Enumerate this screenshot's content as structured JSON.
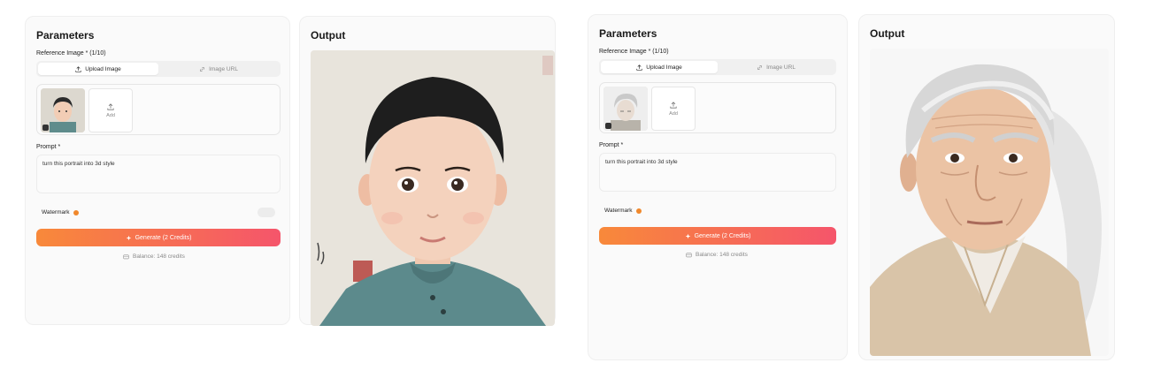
{
  "panels": [
    {
      "parameters_title": "Parameters",
      "reference_label": "Reference Image * (1/10)",
      "tabs": [
        {
          "label": "Upload Image",
          "icon": "upload-icon",
          "active": true
        },
        {
          "label": "Image URL",
          "icon": "link-icon",
          "active": false
        }
      ],
      "thumbnail": "boy-portrait-thumbnail",
      "add_label": "Add",
      "prompt_label": "Prompt *",
      "prompt_value": "turn this portrait into 3d style",
      "watermark_label": "Watermark",
      "generate_label": "Generate (2 Credits)",
      "balance_text": "Balance: 148 credits",
      "output_title": "Output",
      "output_image": "3d-boy-portrait"
    },
    {
      "parameters_title": "Parameters",
      "reference_label": "Reference Image * (1/10)",
      "tabs": [
        {
          "label": "Upload Image",
          "icon": "upload-icon",
          "active": true
        },
        {
          "label": "Image URL",
          "icon": "link-icon",
          "active": false
        }
      ],
      "thumbnail": "old-man-portrait-thumbnail",
      "add_label": "Add",
      "prompt_label": "Prompt *",
      "prompt_value": "turn this portrait into 3d style",
      "watermark_label": "Watermark",
      "generate_label": "Generate (2 Credits)",
      "balance_text": "Balance: 148 credits",
      "output_title": "Output",
      "output_image": "3d-old-man-portrait"
    }
  ],
  "colors": {
    "accent_start": "#f8893a",
    "accent_end": "#f5556b",
    "coin": "#f0882c"
  }
}
